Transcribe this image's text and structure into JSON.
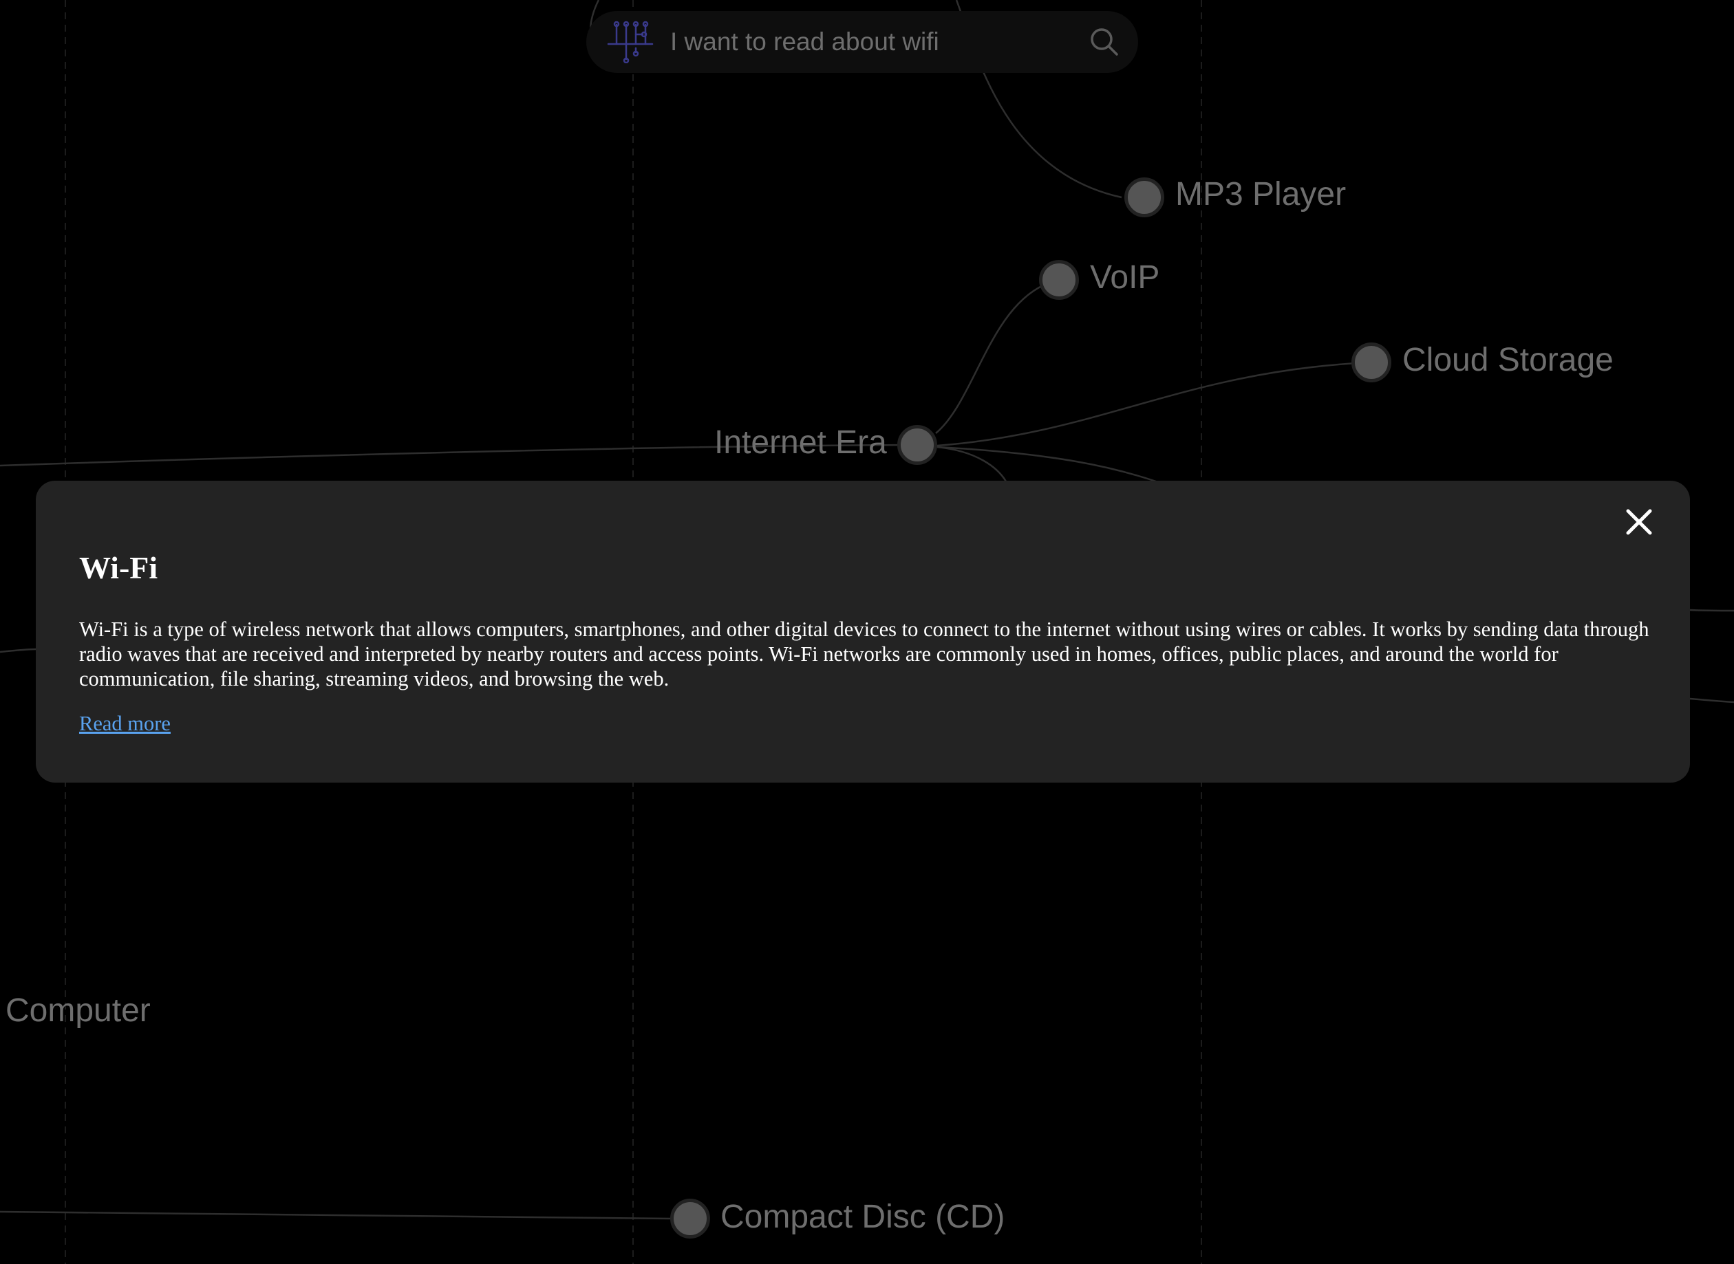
{
  "search": {
    "placeholder": "I want to read about wifi",
    "value": ""
  },
  "graph": {
    "nodes": [
      {
        "id": "mp3",
        "label": "MP3 Player"
      },
      {
        "id": "voip",
        "label": "VoIP"
      },
      {
        "id": "cloud",
        "label": "Cloud Storage"
      },
      {
        "id": "internet",
        "label": "Internet Era"
      },
      {
        "id": "computer",
        "label": "Computer"
      },
      {
        "id": "cd",
        "label": "Compact Disc (CD)"
      }
    ]
  },
  "modal": {
    "title": "Wi-Fi",
    "body": "Wi-Fi is a type of wireless network that allows computers, smartphones, and other digital devices to connect to the internet without using wires or cables. It works by sending data through radio waves that are received and interpreted by nearby routers and access points. Wi-Fi networks are commonly used in homes, offices, public places, and around the world for communication, file sharing, streaming videos, and browsing the web.",
    "link_label": "Read more"
  },
  "colors": {
    "background": "#000000",
    "node_fill": "#555555",
    "label": "#6e6e6e",
    "modal_bg": "#232323",
    "link": "#5aa3f0",
    "logo_accent": "#3a3a8c"
  }
}
